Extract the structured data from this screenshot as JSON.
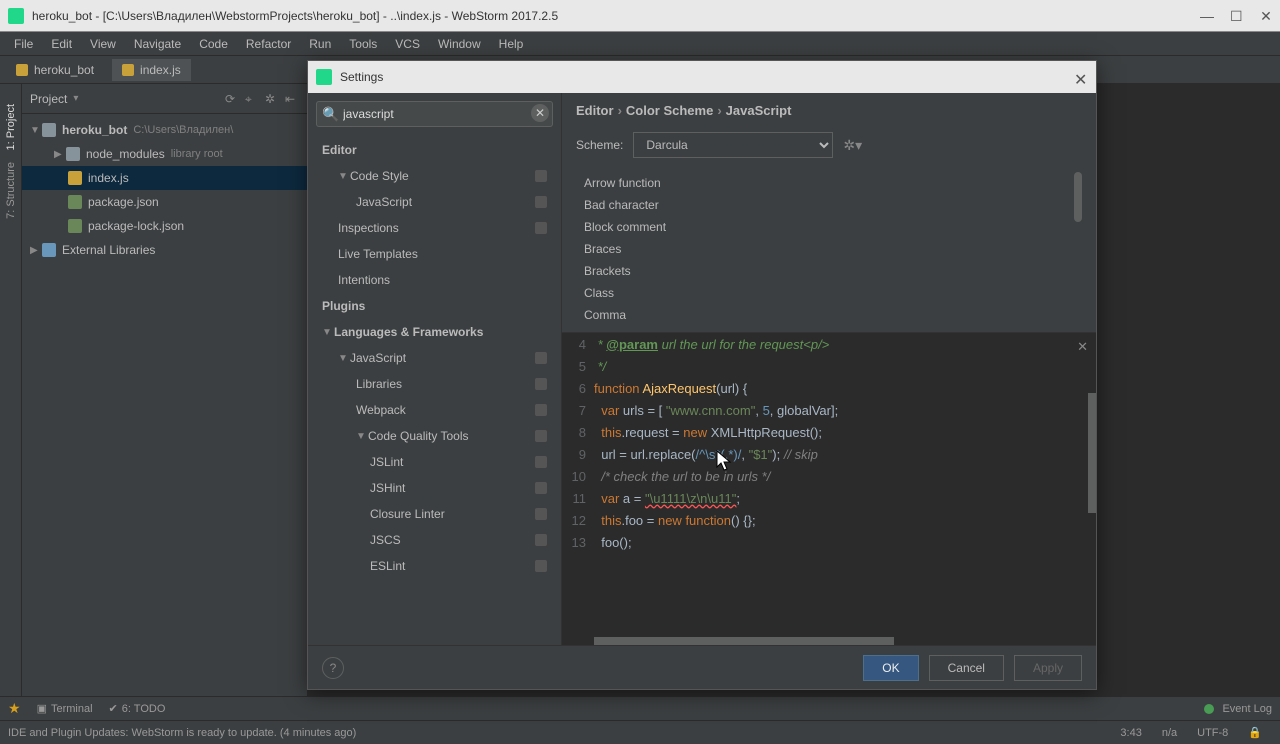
{
  "titlebar": {
    "title": "heroku_bot - [C:\\Users\\Владилен\\WebstormProjects\\heroku_bot] - ..\\index.js - WebStorm 2017.2.5"
  },
  "menu": [
    "File",
    "Edit",
    "View",
    "Navigate",
    "Code",
    "Refactor",
    "Run",
    "Tools",
    "VCS",
    "Window",
    "Help"
  ],
  "tabs": {
    "project_tab": "heroku_bot",
    "file_tab": "index.js"
  },
  "project_panel": {
    "label": "Project",
    "root": "heroku_bot",
    "root_path": "C:\\Users\\Владилен\\",
    "node_modules": "node_modules",
    "lib_root": "library root",
    "index": "index.js",
    "pkg": "package.json",
    "pkglock": "package-lock.json",
    "ext_lib": "External Libraries"
  },
  "left_tools": [
    "1: Project",
    "7: Structure"
  ],
  "bottom": {
    "terminal": "Terminal",
    "todo": "6: TODO",
    "eventlog": "Event Log"
  },
  "status": {
    "msg": "IDE and Plugin Updates: WebStorm is ready to update. (4 minutes ago)",
    "pos": "3:43",
    "sep": "n/a",
    "enc": "UTF-8"
  },
  "settings": {
    "title": "Settings",
    "search": "javascript",
    "breadcrumb": [
      "Editor",
      "Color Scheme",
      "JavaScript"
    ],
    "scheme_label": "Scheme:",
    "scheme_value": "Darcula",
    "tree": {
      "editor": "Editor",
      "code_style": "Code Style",
      "javascript_cs": "JavaScript",
      "inspections": "Inspections",
      "live_templates": "Live Templates",
      "intentions": "Intentions",
      "plugins": "Plugins",
      "lang_fw": "Languages & Frameworks",
      "javascript": "JavaScript",
      "libraries": "Libraries",
      "webpack": "Webpack",
      "cqt": "Code Quality Tools",
      "jslint": "JSLint",
      "jshint": "JSHint",
      "closure": "Closure Linter",
      "jscs": "JSCS",
      "eslint": "ESLint"
    },
    "attrs": [
      "Arrow function",
      "Bad character",
      "Block comment",
      "Braces",
      "Brackets",
      "Class",
      "Comma"
    ],
    "buttons": {
      "ok": "OK",
      "cancel": "Cancel",
      "apply": "Apply"
    },
    "preview": {
      "l4a": " * ",
      "l4tag": "@param",
      "l4b": " url the url for the request<p/>",
      "l5": " */",
      "l6a": "function",
      "l6b": " AjaxRequest",
      "l6c": "(url) {",
      "l7a": "  var",
      "l7b": " urls = [ ",
      "l7c": "\"www.cnn.com\"",
      "l7d": ", ",
      "l7e": "5",
      "l7f": ", globalVar];",
      "l8a": "  this",
      "l8b": ".request = ",
      "l8c": "new",
      "l8d": " XMLHttpRequest();",
      "l9a": "  url = url.replace(",
      "l9b": "/^\\s*(.*)/",
      "l9c": ", ",
      "l9d": "\"$1\"",
      "l9e": "); ",
      "l9f": "// skip",
      "l10": "  /* check the url to be in urls */",
      "l11a": "  var",
      "l11b": " a = ",
      "l11c": "\"\\u1111\\z\\n\\u11\"",
      "l11d": ";",
      "l12a": "  this",
      "l12b": ".foo = ",
      "l12c": "new",
      "l12d": " function",
      "l12e": "() {};",
      "l13": "  foo();"
    }
  }
}
